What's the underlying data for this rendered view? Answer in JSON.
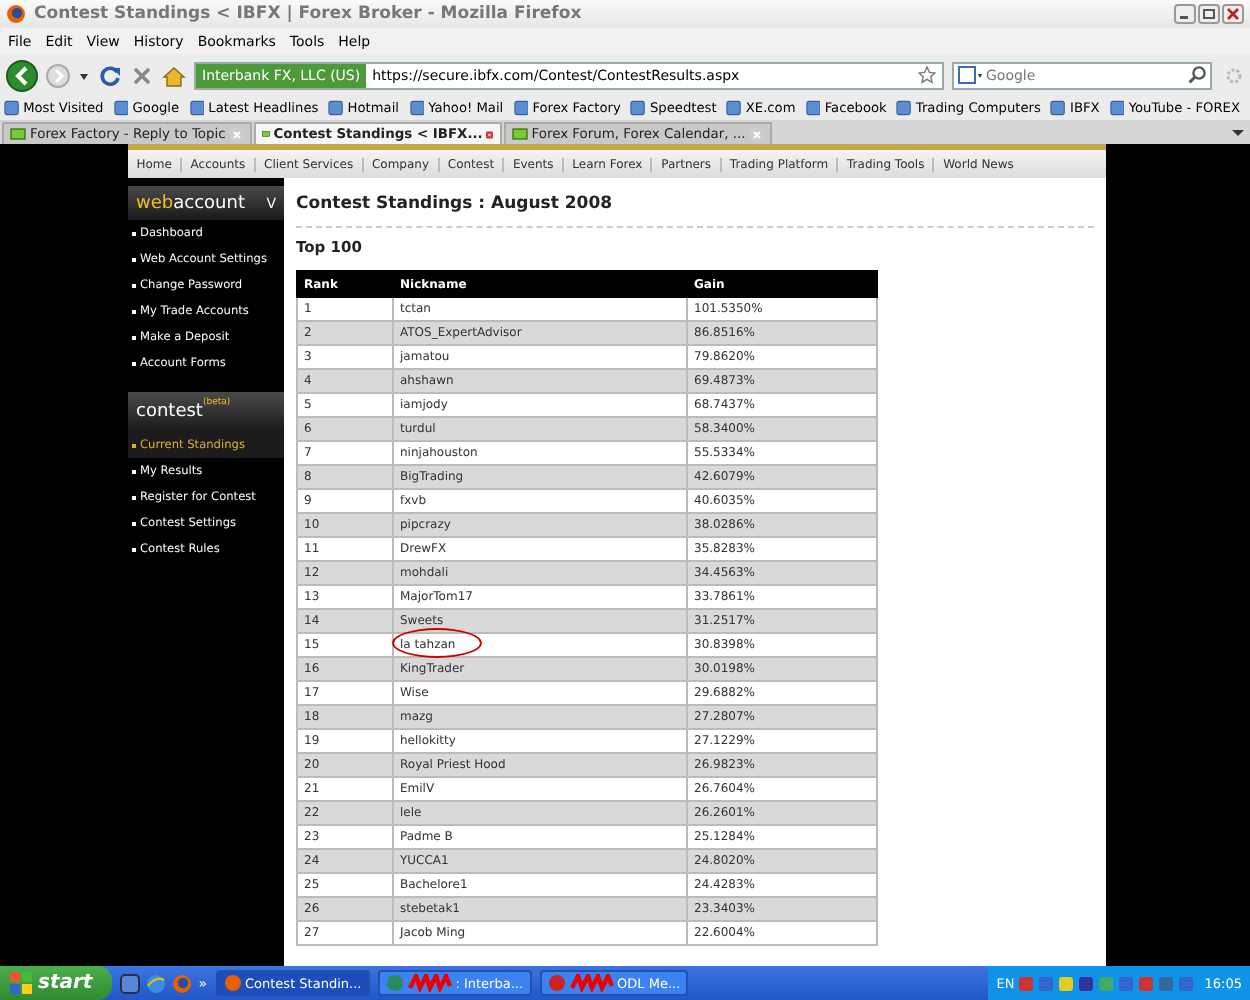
{
  "window": {
    "title": "Contest Standings < IBFX | Forex Broker - Mozilla Firefox"
  },
  "menu": [
    "File",
    "Edit",
    "View",
    "History",
    "Bookmarks",
    "Tools",
    "Help"
  ],
  "navigation": {
    "identity": "Interbank FX, LLC (US)",
    "url": "https://secure.ibfx.com/Contest/ContestResults.aspx",
    "search_placeholder": "Google"
  },
  "bookmarks": [
    "Most Visited",
    "Google",
    "Latest Headlines",
    "Hotmail",
    "Yahoo! Mail",
    "Forex Factory",
    "Speedtest",
    "XE.com",
    "Facebook",
    "Trading Computers",
    "IBFX",
    "YouTube - FOREX"
  ],
  "tabs": [
    {
      "label": "Forex Factory - Reply to Topic",
      "selected": false
    },
    {
      "label": "Contest Standings < IBFX...",
      "selected": true
    },
    {
      "label": "Forex Forum, Forex Calendar, ...",
      "selected": false
    }
  ],
  "site_nav": [
    "Home",
    "Accounts",
    "Client Services",
    "Company",
    "Contest",
    "Events",
    "Learn Forex",
    "Partners",
    "Trading Platform",
    "Trading Tools",
    "World News"
  ],
  "sidebar": [
    {
      "prefix": "web",
      "title": "account",
      "toggle": "V",
      "items": [
        {
          "label": "Dashboard",
          "selected": false
        },
        {
          "label": "Web Account Settings",
          "selected": false
        },
        {
          "label": "Change Password",
          "selected": false
        },
        {
          "label": "My Trade Accounts",
          "selected": false
        },
        {
          "label": "Make a Deposit",
          "selected": false
        },
        {
          "label": "Account Forms",
          "selected": false
        }
      ]
    },
    {
      "title": "contest",
      "badge": "(beta)",
      "items": [
        {
          "label": "Current Standings",
          "selected": true
        },
        {
          "label": "My Results",
          "selected": false
        },
        {
          "label": "Register for Contest",
          "selected": false
        },
        {
          "label": "Contest Settings",
          "selected": false
        },
        {
          "label": "Contest Rules",
          "selected": false
        }
      ]
    }
  ],
  "heading": "Contest Standings : August 2008",
  "subheading": "Top 100",
  "table": {
    "columns": [
      "Rank",
      "Nickname",
      "Gain"
    ],
    "rows": [
      {
        "cells": [
          "1",
          "tctan",
          "101.5350%"
        ],
        "circled": false
      },
      {
        "cells": [
          "2",
          "ATOS_ExpertAdvisor",
          "86.8516%"
        ],
        "circled": false
      },
      {
        "cells": [
          "3",
          "jamatou",
          "79.8620%"
        ],
        "circled": false
      },
      {
        "cells": [
          "4",
          "ahshawn",
          "69.4873%"
        ],
        "circled": false
      },
      {
        "cells": [
          "5",
          "iamjody",
          "68.7437%"
        ],
        "circled": false
      },
      {
        "cells": [
          "6",
          "turdul",
          "58.3400%"
        ],
        "circled": false
      },
      {
        "cells": [
          "7",
          "ninjahouston",
          "55.5334%"
        ],
        "circled": false
      },
      {
        "cells": [
          "8",
          "BigTrading",
          "42.6079%"
        ],
        "circled": false
      },
      {
        "cells": [
          "9",
          "fxvb",
          "40.6035%"
        ],
        "circled": false
      },
      {
        "cells": [
          "10",
          "pipcrazy",
          "38.0286%"
        ],
        "circled": false
      },
      {
        "cells": [
          "11",
          "DrewFX",
          "35.8283%"
        ],
        "circled": false
      },
      {
        "cells": [
          "12",
          "mohdali",
          "34.4563%"
        ],
        "circled": false
      },
      {
        "cells": [
          "13",
          "MajorTom17",
          "33.7861%"
        ],
        "circled": false
      },
      {
        "cells": [
          "14",
          "Sweets",
          "31.2517%"
        ],
        "circled": false
      },
      {
        "cells": [
          "15",
          "la tahzan",
          "30.8398%"
        ],
        "circled": true
      },
      {
        "cells": [
          "16",
          "KingTrader",
          "30.0198%"
        ],
        "circled": false
      },
      {
        "cells": [
          "17",
          "Wise",
          "29.6882%"
        ],
        "circled": false
      },
      {
        "cells": [
          "18",
          "mazg",
          "27.2807%"
        ],
        "circled": false
      },
      {
        "cells": [
          "19",
          "hellokitty",
          "27.1229%"
        ],
        "circled": false
      },
      {
        "cells": [
          "20",
          "Royal Priest Hood",
          "26.9823%"
        ],
        "circled": false
      },
      {
        "cells": [
          "21",
          "EmilV",
          "26.7604%"
        ],
        "circled": false
      },
      {
        "cells": [
          "22",
          "lele",
          "26.2601%"
        ],
        "circled": false
      },
      {
        "cells": [
          "23",
          "Padme B",
          "25.1284%"
        ],
        "circled": false
      },
      {
        "cells": [
          "24",
          "YUCCA1",
          "24.8020%"
        ],
        "circled": false
      },
      {
        "cells": [
          "25",
          "Bachelore1",
          "24.4283%"
        ],
        "circled": false
      },
      {
        "cells": [
          "26",
          "stebetak1",
          "23.3403%"
        ],
        "circled": false
      },
      {
        "cells": [
          "27",
          "Jacob Ming",
          "22.6004%"
        ],
        "circled": false
      }
    ]
  },
  "taskbar": {
    "start": "start",
    "overflow": "»",
    "tasks": [
      {
        "label": "Contest Standin...",
        "redacted": false
      },
      {
        "label": ": Interba...",
        "redacted": true
      },
      {
        "label": "ODL Me...",
        "redacted": true
      }
    ],
    "language": "EN",
    "clock": "16:05"
  }
}
